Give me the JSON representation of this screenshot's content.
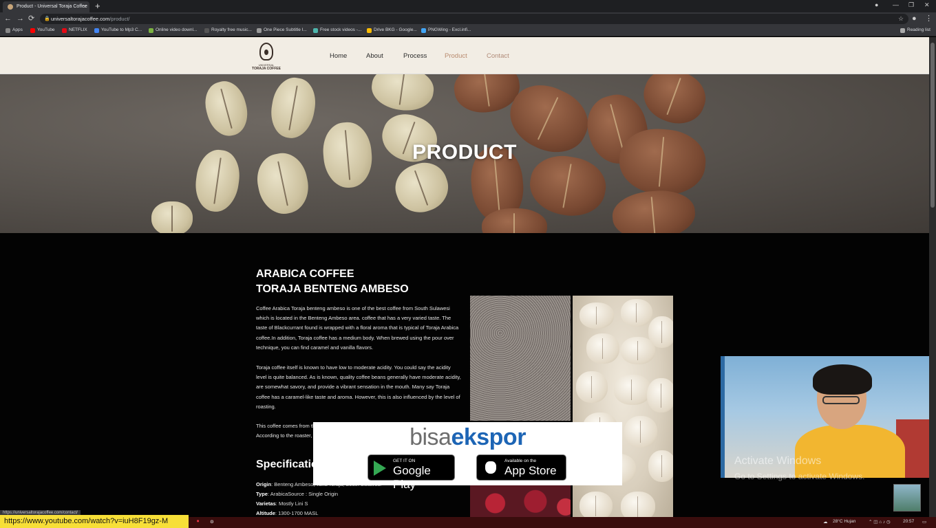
{
  "browser": {
    "tab_title": "Product - Universal Toraja Coffee",
    "tab_close": "×",
    "new_tab": "+",
    "url_host": "universaltorajacoffee.com",
    "url_path": "/product/",
    "reading_list": "Reading list",
    "back": "←",
    "forward": "→",
    "reload": "⟳"
  },
  "bookmarks": [
    {
      "label": "Apps",
      "color": "#9aa0a6"
    },
    {
      "label": "YouTube",
      "color": "#ff0000"
    },
    {
      "label": "NETFLIX",
      "color": "#e50914"
    },
    {
      "label": "YouTube to Mp3 C...",
      "color": "#4285f4"
    },
    {
      "label": "Online video downl...",
      "color": "#7cb342"
    },
    {
      "label": "Royalty free music...",
      "color": "#555555"
    },
    {
      "label": "One Piece Subtitle I...",
      "color": "#999999"
    },
    {
      "label": "Free stock videos -...",
      "color": "#4db6ac"
    },
    {
      "label": "Drive BKG - Google...",
      "color": "#fbbc04"
    },
    {
      "label": "PNGWing - Excl.infi...",
      "color": "#42a5f5"
    }
  ],
  "site": {
    "brand_line1": "UNIVERSAL",
    "brand_line2": "TORAJA COFFEE",
    "nav": [
      "Home",
      "About",
      "Process",
      "Product",
      "Contact"
    ],
    "hero_title": "PRODUCT"
  },
  "product": {
    "heading_line1": "ARABICA COFFEE",
    "heading_line2": "TORAJA BENTENG AMBESO",
    "para1": "Coffee Arabica Toraja benteng ambeso is one of the best coffee from South Sulawesi which is located in the Benteng Ambeso area. coffee that has a very varied taste. The taste of Blackcurrant found is wrapped with a floral aroma that is typical of Toraja Arabica coffee.In addition, Toraja coffee has a medium body. When brewed using the pour over technique, you can find caramel and vanilla flavors.",
    "para2": "Toraja coffee itself is known to have low to moderate acidity. You could say the acidity level is quite balanced. As is known, quality coffee beans generally have moderate acidity, are somewhat savory, and provide a vibrant sensation in the mouth. Many say Toraja coffee has a caramel-like taste and aroma. However, this is also influenced by the level of roasting.",
    "para3": "This coffee comes from the Benteng Ambeso area, Tana Toraja, South Sulawesi. According to the roaster, this coffee has a distinctive flavor that gives a taste of caramel...",
    "spec_title": "Specifications",
    "specs": [
      {
        "label": "Origin",
        "value": ": Benteng Ambeso, Tana Toraja, South Sulawesi"
      },
      {
        "label": "Type",
        "value": ": ArabicaSource : Single Origin"
      },
      {
        "label": "Varietas",
        "value": ": Mostly Lini S"
      },
      {
        "label": "Altitude",
        "value": ": 1300-1700 MASL"
      }
    ]
  },
  "ad": {
    "logo_part1": "bisa",
    "logo_part2": "ekspor",
    "gp_small": "GET IT ON",
    "gp_big": "Google Play",
    "as_small": "Available on the",
    "as_big": "App Store"
  },
  "overlay": {
    "activate_title": "Activate Windows",
    "activate_sub": "Go to Settings to activate Windows.",
    "status_url": "https://universaltorajacoffee.com/contact/",
    "yt_url": "https://www.youtube.com/watch?v=iuH8F19gz-M"
  },
  "taskbar": {
    "weather": "28°C  Hujan",
    "time": "20:57"
  }
}
